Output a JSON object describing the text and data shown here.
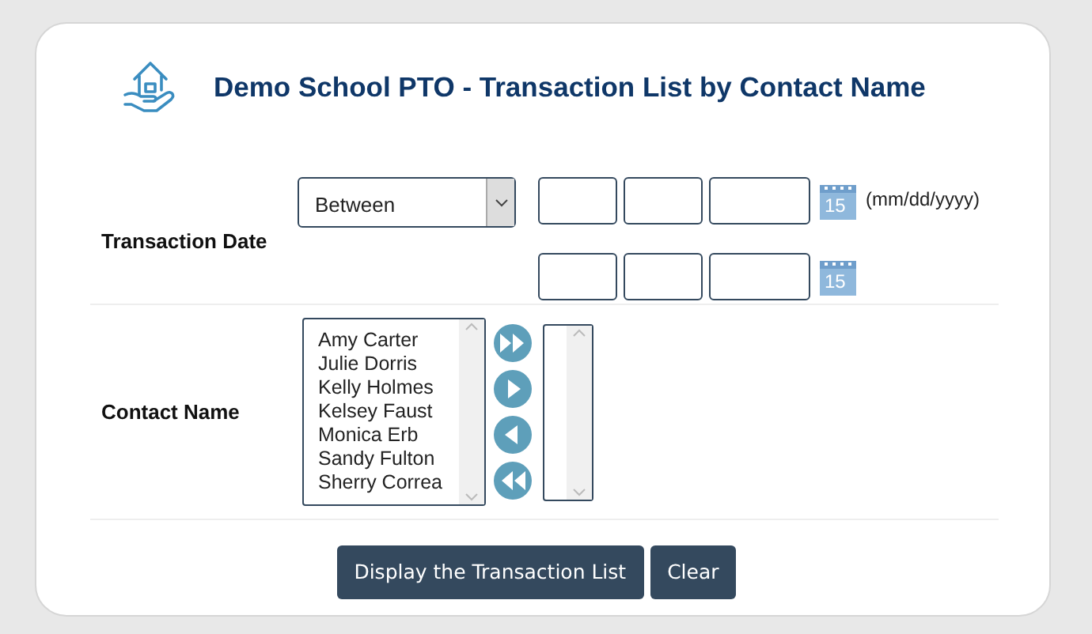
{
  "title": "Demo School PTO - Transaction List by Contact Name",
  "transaction_date": {
    "label": "Transaction Date",
    "operator": "Between",
    "date_rows": [
      {
        "calendar_day": "15",
        "format_hint": "(mm/dd/yyyy)"
      },
      {
        "calendar_day": "15"
      }
    ]
  },
  "contact_name": {
    "label": "Contact Name",
    "available": [
      "Amy Carter",
      "Julie Dorris",
      "Kelly Holmes",
      "Kelsey Faust",
      "Monica Erb",
      "Sandy Fulton",
      "Sherry Correa"
    ]
  },
  "buttons": [
    "Display the Transaction List",
    "Clear"
  ]
}
